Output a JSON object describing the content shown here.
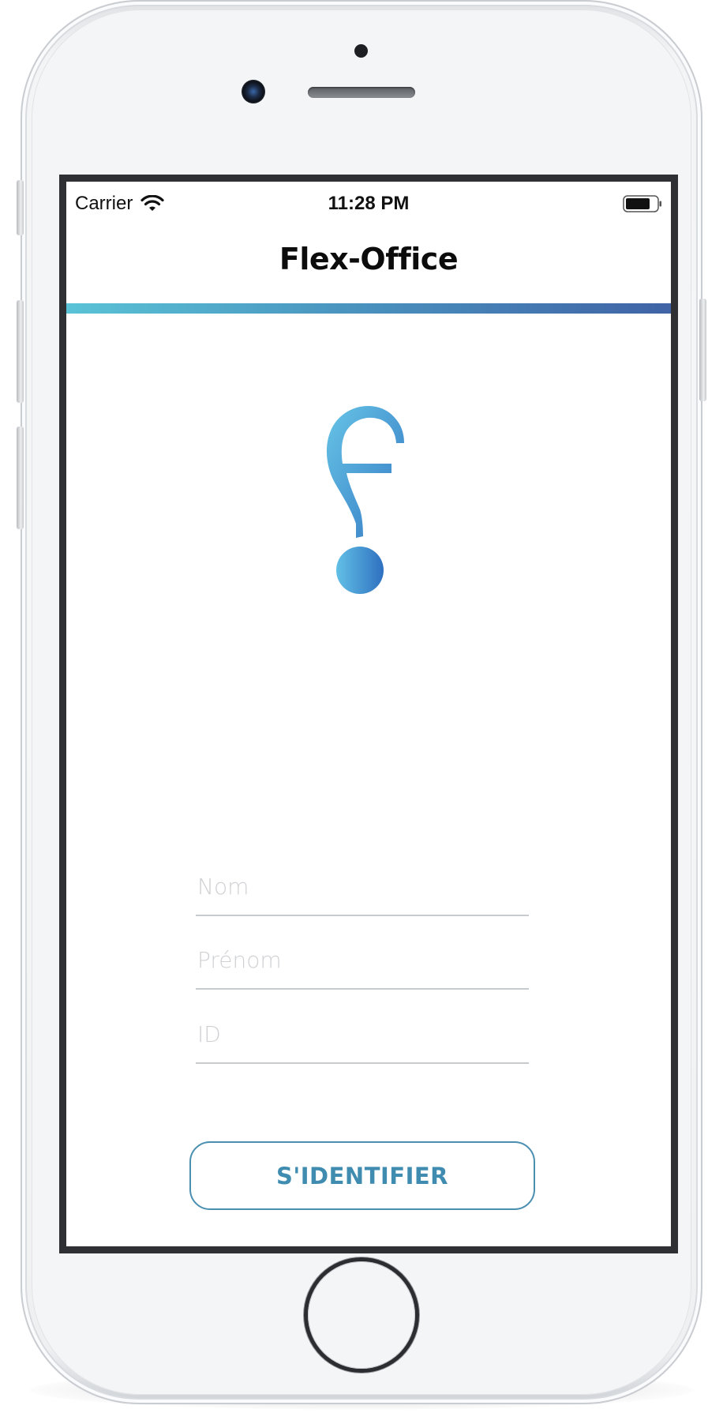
{
  "status_bar": {
    "carrier": "Carrier",
    "time": "11:28 PM",
    "wifi_icon": "wifi-icon",
    "battery_icon": "battery-full-icon"
  },
  "nav": {
    "title": "Flex-Office",
    "accent_gradient": [
      "#5ac3d6",
      "#4a95c0",
      "#4063a6"
    ]
  },
  "logo": {
    "icon": "flex-office-logo",
    "colors": [
      "#5ab8de",
      "#3a7fc7"
    ]
  },
  "form": {
    "nom": {
      "placeholder": "Nom",
      "value": ""
    },
    "prenom": {
      "placeholder": "Prénom",
      "value": ""
    },
    "id": {
      "placeholder": "ID",
      "value": ""
    },
    "submit_label": "S'IDENTIFIER"
  },
  "colors": {
    "button_text": "#3f8cb0",
    "button_border": "#4a8fb0",
    "placeholder": "#cfd1d4"
  }
}
